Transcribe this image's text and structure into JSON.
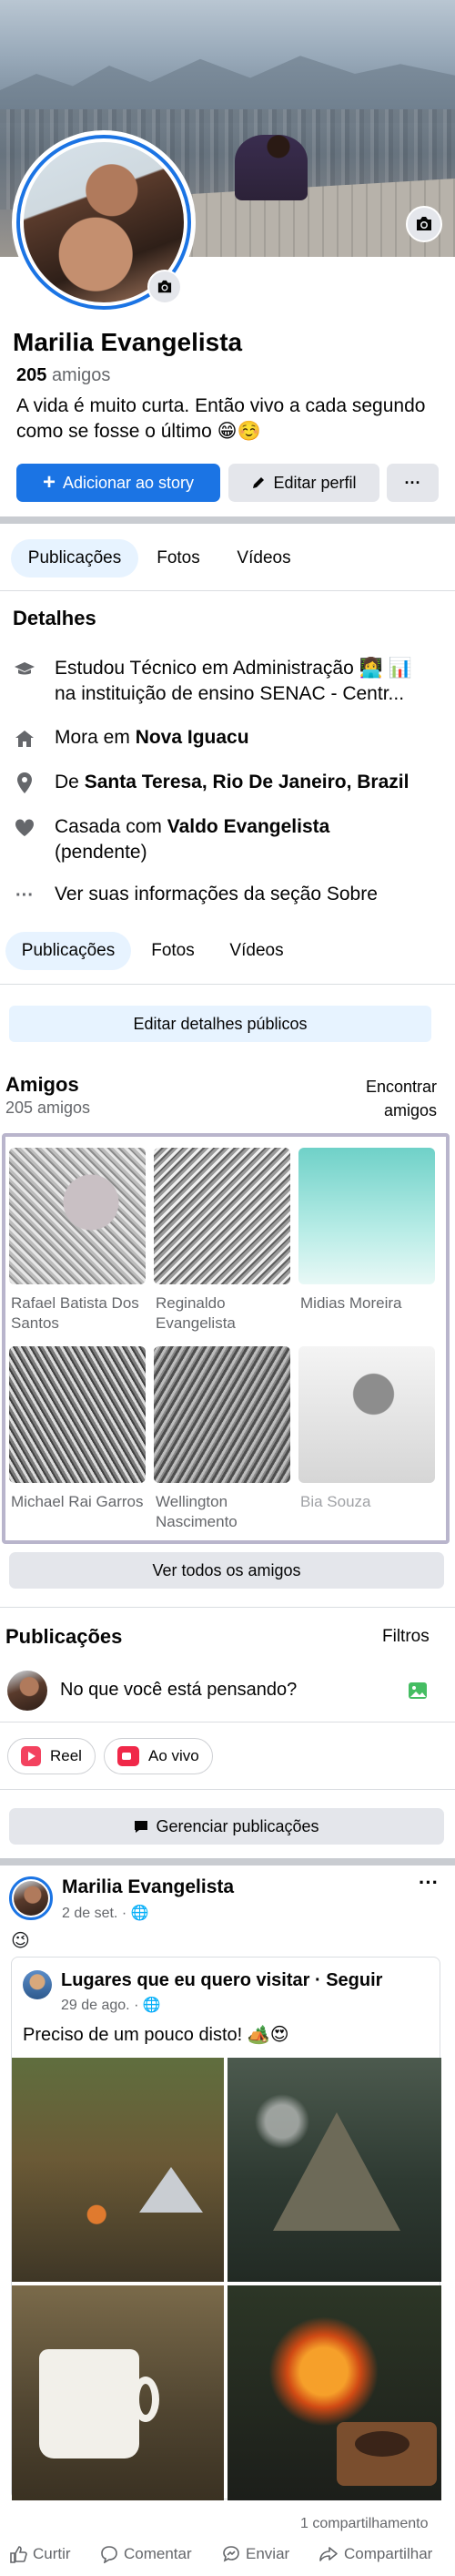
{
  "profile": {
    "name": "Marilia Evangelista",
    "friends_count": "205",
    "friends_word": "amigos",
    "bio": "A vida é muito curta. Então vivo a cada segundo como se fosse o último 😁☺️"
  },
  "actions": {
    "add_story": "Adicionar ao story",
    "edit_profile": "Editar perfil",
    "more": "···"
  },
  "tabs": [
    "Publicações",
    "Fotos",
    "Vídeos"
  ],
  "details": {
    "title": "Detalhes",
    "education": "Estudou Técnico em Administração 👩‍💻 📊 na instituição de ensino SENAC - Centr...",
    "lives_prefix": "Mora em ",
    "lives_city": "Nova Iguacu",
    "from_prefix": "De ",
    "from_city": "Santa Teresa, Rio De Janeiro, Brazil",
    "married_prefix": "Casada com ",
    "married_name": "Valdo Evangelista",
    "married_status": "(pendente)",
    "see_about": "Ver suas informações da seção Sobre",
    "edit_public": "Editar detalhes públicos"
  },
  "friends": {
    "title": "Amigos",
    "count": "205 amigos",
    "find_line1": "Encontrar",
    "find_line2": "amigos",
    "list": [
      {
        "name": "Rafael Batista Dos Santos"
      },
      {
        "name": "Reginaldo Evangelista"
      },
      {
        "name": "Midias Moreira"
      },
      {
        "name": "Michael Rai Garros"
      },
      {
        "name": "Wellington Nascimento"
      },
      {
        "name": "Bia Souza"
      }
    ],
    "see_all": "Ver todos os amigos"
  },
  "publications": {
    "title": "Publicações",
    "filters": "Filtros",
    "composer_placeholder": "No que você está pensando?",
    "reel": "Reel",
    "live": "Ao vivo",
    "manage": "Gerenciar publicações"
  },
  "post": {
    "author": "Marilia Evangelista",
    "date": "2 de set. · 🌐",
    "text": "😉",
    "shared_author": "Lugares que eu quero visitar",
    "shared_follow": "Seguir",
    "shared_date": "29 de ago. · 🌐",
    "shared_text": "Preciso de um pouco disto! 🏕️😍",
    "shares": "1 compartilhamento",
    "like": "Curtir",
    "comment": "Comentar",
    "send": "Enviar",
    "share": "Compartilhar"
  },
  "colors": {
    "accent": "#1b74e4",
    "tab_active_bg": "#e7f3ff",
    "button_gray": "#e4e6eb",
    "text_secondary": "#65676b"
  },
  "icons": [
    "camera-icon",
    "plus-icon",
    "pencil-icon",
    "graduation-cap-icon",
    "home-icon",
    "location-pin-icon",
    "heart-icon",
    "ellipsis-icon",
    "image-icon",
    "reel-icon",
    "live-video-icon",
    "message-icon",
    "globe-icon",
    "like-icon",
    "comment-icon",
    "send-icon",
    "share-icon"
  ]
}
